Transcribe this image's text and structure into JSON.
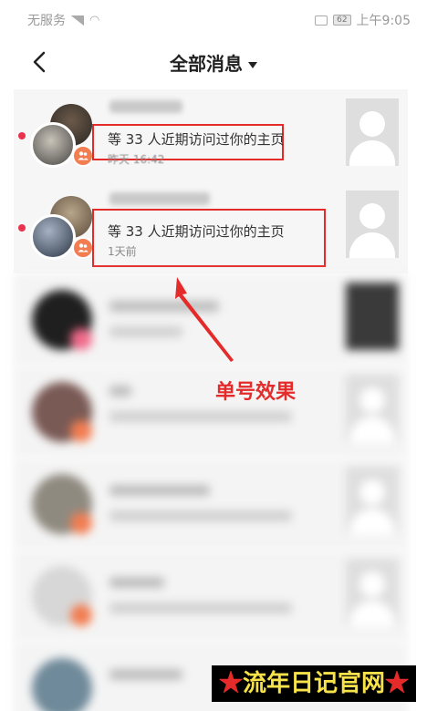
{
  "status_bar": {
    "carrier": "无服务",
    "battery": "62",
    "time": "上午9:05"
  },
  "header": {
    "title": "全部消息"
  },
  "messages": [
    {
      "blurred_name": "",
      "text": "等 33 人近期访问过你的主页",
      "time": "昨天 16:42",
      "unread": true
    },
    {
      "blurred_name": "",
      "text": "等 33 人近期访问过你的主页",
      "time": "1天前",
      "unread": true
    }
  ],
  "annotation": {
    "label": "单号效果"
  },
  "watermark": {
    "star_left": "★",
    "text": "流年日记官网",
    "star_right": "★"
  },
  "colors": {
    "highlight": "#e52a2a",
    "badge": "#f27d51",
    "unread": "#e8324e"
  }
}
